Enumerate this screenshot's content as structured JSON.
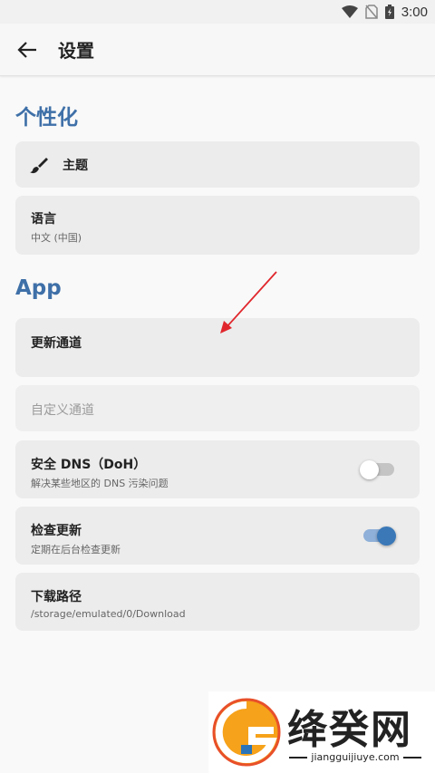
{
  "status_bar": {
    "time": "3:00"
  },
  "app_bar": {
    "title": "设置"
  },
  "sections": {
    "personalization_title": "个性化",
    "app_title": "App"
  },
  "items": {
    "theme": {
      "label": "主题"
    },
    "language": {
      "label": "语言",
      "value": "中文 (中国)"
    },
    "update_channel": {
      "label": "更新通道"
    },
    "custom_channel": {
      "placeholder": "自定义通道"
    },
    "secure_dns": {
      "label": "安全 DNS（DoH）",
      "description": "解决某些地区的 DNS 污染问题",
      "enabled": false
    },
    "check_updates": {
      "label": "检查更新",
      "description": "定期在后台检查更新",
      "enabled": true
    },
    "download_path": {
      "label": "下载路径",
      "value": "/storage/emulated/0/Download"
    }
  },
  "watermark": {
    "brand": "绛癸网",
    "domain": "jiangguijiuye.com"
  },
  "colors": {
    "accent": "#3f70a8",
    "toggle_on_thumb": "#3a78b8",
    "toggle_on_track": "#8fb0d8",
    "toggle_off_thumb": "#ffffff",
    "toggle_off_track": "#c4c4c4",
    "annotation_arrow": "#e0262c"
  }
}
